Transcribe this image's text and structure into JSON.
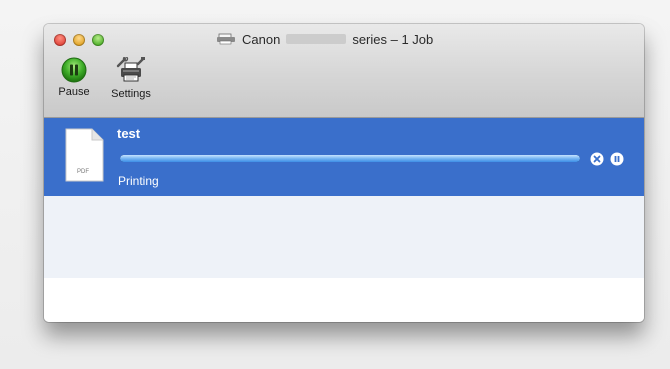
{
  "window": {
    "title_prefix": "Canon",
    "title_suffix": "series – 1 Job"
  },
  "icons": {
    "close": "close-window-icon",
    "minimize": "minimize-window-icon",
    "zoom": "zoom-window-icon",
    "printer": "printer-icon",
    "pause": "pause-icon",
    "settings": "settings-icon",
    "document": "pdf-document-icon",
    "delete_job": "delete-job-icon",
    "hold_job": "hold-job-icon"
  },
  "toolbar": {
    "pause_label": "Pause",
    "settings_label": "Settings"
  },
  "job": {
    "name": "test",
    "file_type": "PDF",
    "status": "Printing",
    "progress": 1.0
  },
  "colors": {
    "selection": "#3a6fcb",
    "progress": "#77b6f3",
    "pause_button": "#3fae29"
  }
}
